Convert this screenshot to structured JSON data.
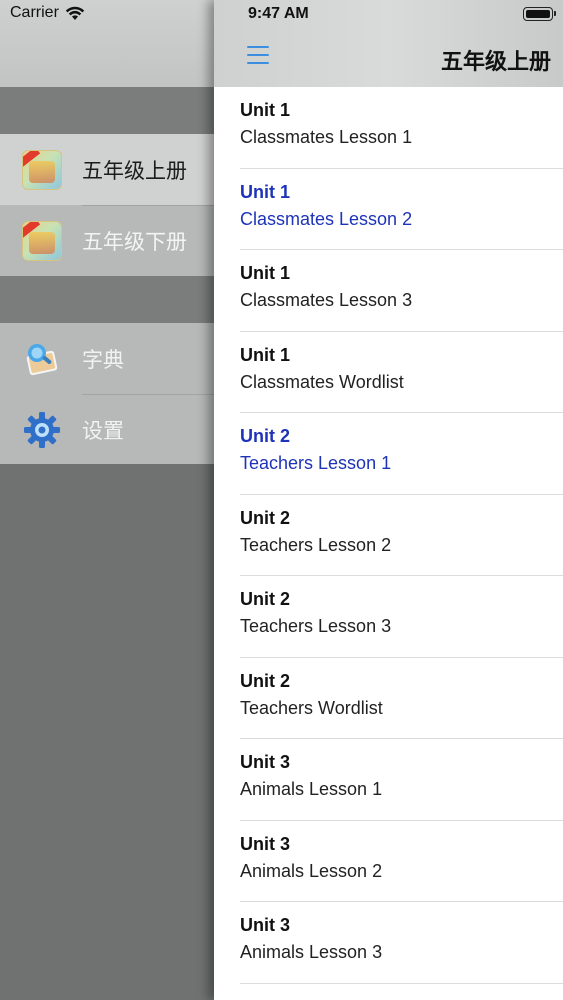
{
  "status_bar": {
    "carrier": "Carrier",
    "time": "9:47 AM"
  },
  "drawer": {
    "books": [
      {
        "label": "五年级上册",
        "icon": "textbook-icon",
        "selected": true
      },
      {
        "label": "五年级下册",
        "icon": "textbook-icon",
        "selected": false
      }
    ],
    "tools": [
      {
        "label": "字典",
        "icon": "dictionary-icon"
      },
      {
        "label": "设置",
        "icon": "gear-icon"
      }
    ]
  },
  "nav": {
    "title": "五年级上册",
    "menu_icon": "hamburger-menu-icon"
  },
  "lessons": [
    {
      "unit": "Unit 1",
      "title": "Classmates Lesson 1",
      "highlight": false
    },
    {
      "unit": "Unit 1",
      "title": "Classmates Lesson 2",
      "highlight": true
    },
    {
      "unit": "Unit 1",
      "title": "Classmates Lesson 3",
      "highlight": false
    },
    {
      "unit": "Unit 1",
      "title": "Classmates Wordlist",
      "highlight": false
    },
    {
      "unit": "Unit 2",
      "title": "Teachers Lesson 1",
      "highlight": true
    },
    {
      "unit": "Unit 2",
      "title": "Teachers Lesson 2",
      "highlight": false
    },
    {
      "unit": "Unit 2",
      "title": "Teachers Lesson 3",
      "highlight": false
    },
    {
      "unit": "Unit 2",
      "title": "Teachers Wordlist",
      "highlight": false
    },
    {
      "unit": "Unit 3",
      "title": "Animals Lesson 1",
      "highlight": false
    },
    {
      "unit": "Unit 3",
      "title": "Animals Lesson 2",
      "highlight": false
    },
    {
      "unit": "Unit 3",
      "title": "Animals Lesson 3",
      "highlight": false
    }
  ],
  "colors": {
    "highlight_text": "#1e33b8",
    "menu_icon": "#3b8fe0"
  }
}
